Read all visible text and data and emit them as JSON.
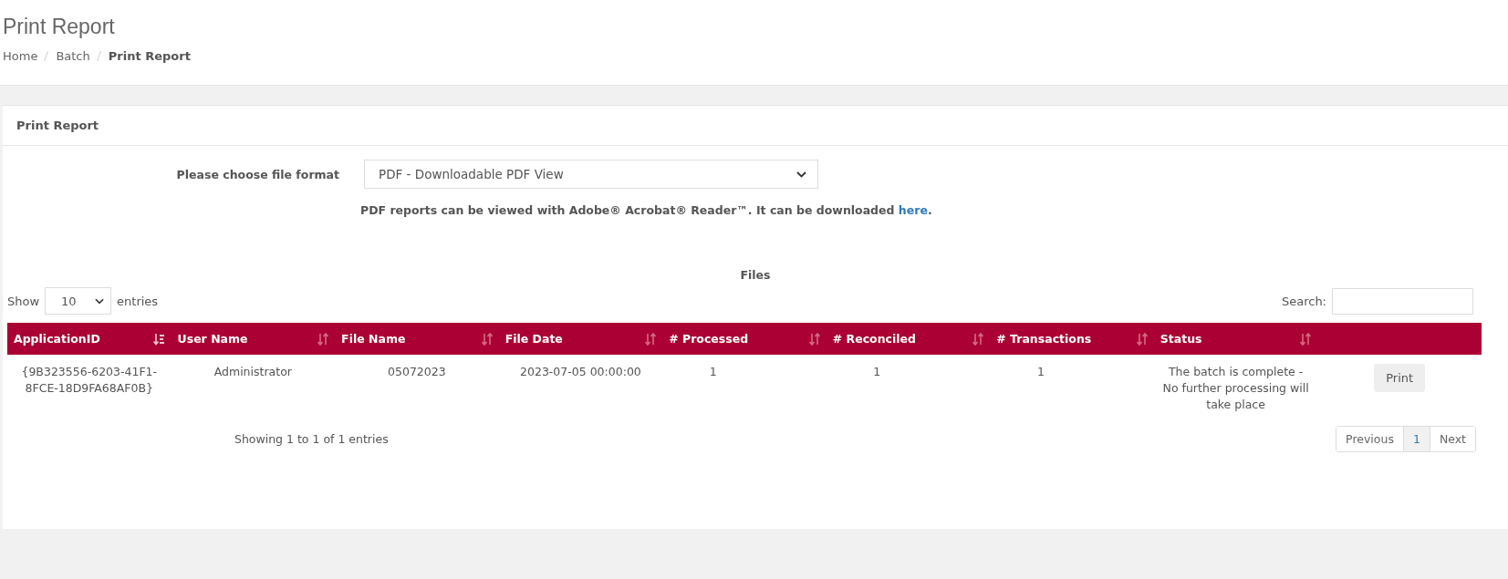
{
  "page_title": "Print Report",
  "breadcrumb": [
    {
      "label": "Home",
      "current": false
    },
    {
      "label": "Batch",
      "current": false
    },
    {
      "label": "Print Report",
      "current": true
    }
  ],
  "panel": {
    "title": "Print Report",
    "format_label": "Please choose file format",
    "format_value": "PDF - Downloadable PDF View",
    "note": "PDF reports can be viewed with Adobe® Acrobat® Reader™. It can be downloaded ",
    "note_link": "here",
    "note_end": ".",
    "table_title": "Files",
    "show_label": "Show",
    "page_size": "10",
    "entries_label": "entries",
    "search_label": "Search:",
    "columns": [
      {
        "label": "ApplicationID",
        "sorted": true
      },
      {
        "label": "User Name",
        "sorted": false
      },
      {
        "label": "File Name",
        "sorted": false
      },
      {
        "label": "File Date",
        "sorted": false
      },
      {
        "label": "# Processed",
        "sorted": false
      },
      {
        "label": "# Reconciled",
        "sorted": false
      },
      {
        "label": "# Transactions",
        "sorted": false
      },
      {
        "label": "Status",
        "sorted": false
      }
    ],
    "rows": [
      {
        "cells": [
          "{9B323556-6203-41F1-8FCE-18D9FA68AF0B}",
          "Administrator",
          "05072023",
          "2023-07-05 00:00:00",
          "1",
          "1",
          "1",
          "The batch is complete - No further processing will take place"
        ],
        "action": "Print"
      }
    ],
    "info": "Showing 1 to 1 of 1 entries",
    "pagination": [
      {
        "label": "Previous",
        "disabled": true,
        "selected": false
      },
      {
        "label": "1",
        "disabled": false,
        "selected": true
      },
      {
        "label": "Next",
        "disabled": true,
        "selected": false
      }
    ]
  }
}
